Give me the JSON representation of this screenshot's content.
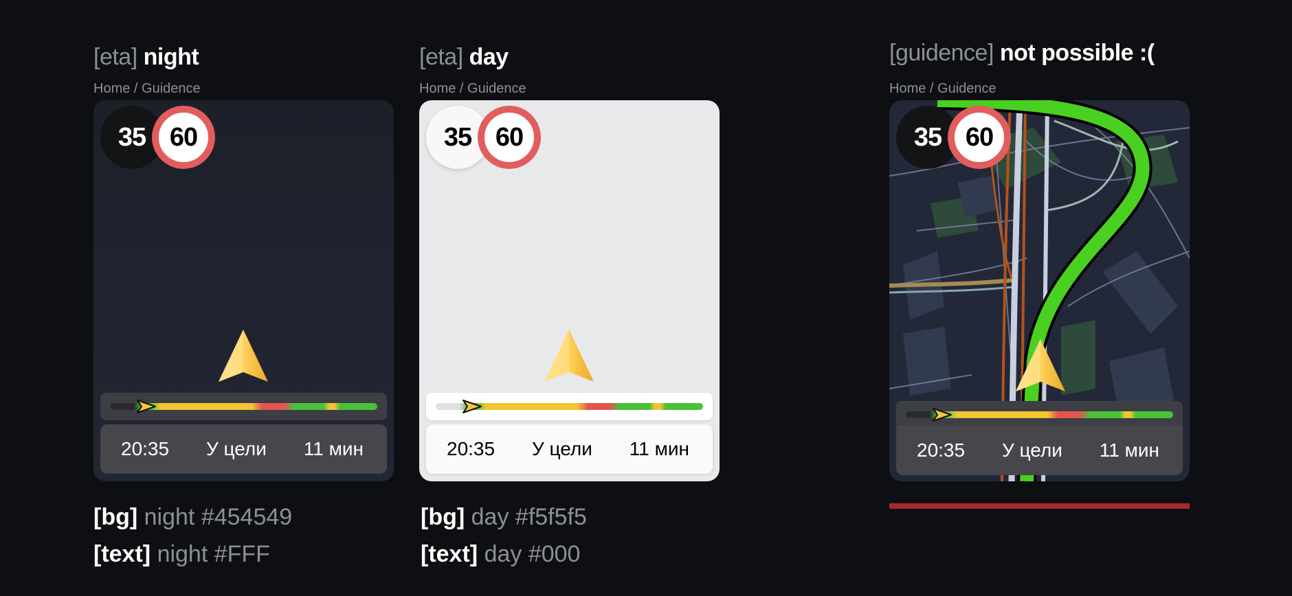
{
  "panels": {
    "night": {
      "title_bracket": "[eta]",
      "title_word": "night",
      "breadcrumb": "Home / Guidence",
      "current_speed": "35",
      "speed_limit": "60",
      "eta": {
        "time": "20:35",
        "status": "У цели",
        "duration": "11 мин"
      },
      "progress": 0.12,
      "bg_color": "#454549",
      "text_color": "#FFF"
    },
    "day": {
      "title_bracket": "[eta]",
      "title_word": "day",
      "breadcrumb": "Home / Guidence",
      "current_speed": "35",
      "speed_limit": "60",
      "eta": {
        "time": "20:35",
        "status": "У цели",
        "duration": "11 мин"
      },
      "progress": 0.12,
      "bg_color": "#f5f5f5",
      "text_color": "#000"
    },
    "guidance": {
      "title_bracket": "[guidence]",
      "title_word": "not possible :(",
      "breadcrumb": "Home / Guidence",
      "current_speed": "35",
      "speed_limit": "60",
      "eta": {
        "time": "20:35",
        "status": "У цели",
        "duration": "11 мин"
      },
      "progress": 0.12
    }
  },
  "notes": {
    "night_bg_tag": "[bg]",
    "night_bg_val": "night #454549",
    "night_text_tag": "[text]",
    "night_text_val": "night #FFF",
    "day_bg_tag": "[bg]",
    "day_bg_val": "day #f5f5f5",
    "day_text_tag": "[text]",
    "day_text_val": "day #000"
  },
  "colors": {
    "page_bg": "#0e0f12",
    "speed_limit_ring": "#e25d5d",
    "route_green": "#49c23a",
    "traffic_yellow": "#f2c531",
    "traffic_red": "#e5544f",
    "error_line": "#a52a2f"
  },
  "icons": {
    "navigation_cursor": "navigation-arrow-icon",
    "position_marker": "position-arrow-icon"
  }
}
